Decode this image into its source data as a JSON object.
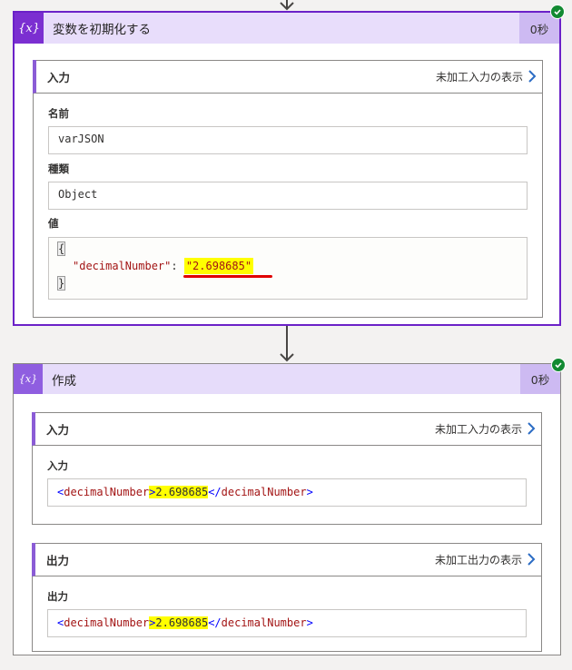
{
  "card1": {
    "icon_text": "{x}",
    "title": "変数を初期化する",
    "duration": "0秒",
    "status": "succeeded",
    "input_section": {
      "label": "入力",
      "raw_link": "未加工入力の表示",
      "fields": {
        "name_label": "名前",
        "name_value": "varJSON",
        "type_label": "種類",
        "type_value": "Object",
        "value_label": "値",
        "value_open": "{",
        "value_key": "\"decimalNumber\"",
        "value_colon": ": ",
        "value_string": "\"2.698685\"",
        "value_close": "}"
      }
    }
  },
  "card2": {
    "icon_text": "{𝑥}",
    "title": "作成",
    "duration": "0秒",
    "status": "succeeded",
    "input_section": {
      "label": "入力",
      "raw_link": "未加工入力の表示",
      "field_label": "入力",
      "lt": "<",
      "open_tag": "decimalNumber",
      "gt": ">",
      "value": "2.698685",
      "close_lt": "</",
      "close_tag": "decimalNumber",
      "close_gt": ">"
    },
    "output_section": {
      "label": "出力",
      "raw_link": "未加工出力の表示",
      "field_label": "出力",
      "lt": "<",
      "open_tag": "decimalNumber",
      "gt": ">",
      "value": "2.698685",
      "close_lt": "</",
      "close_tag": "decimalNumber",
      "close_gt": ">"
    }
  },
  "colors": {
    "accent": "#7b2fd1",
    "header_bg": "#e6dcfa",
    "success": "#128a32",
    "highlight": "#ffff00",
    "underline": "#e00000"
  }
}
